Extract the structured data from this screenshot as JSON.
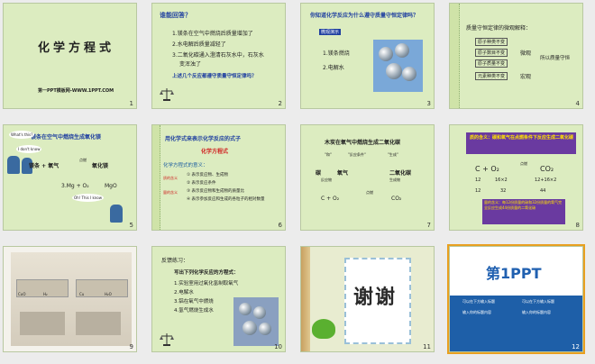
{
  "slides": [
    {
      "n": "1",
      "title": "化学方程式",
      "footer": "第一PPT模板网-WWW.1PPT.COM"
    },
    {
      "n": "2",
      "heading": "谁能回答？",
      "items": [
        "1.镁条在空气中燃烧后质量增加了",
        "2.水电解后质量减轻了",
        "3.二氧化碳通入澄清石灰水中，石灰水",
        "变浑浊了"
      ],
      "question": "上述几个反应都遵守质量守恒定律吗？"
    },
    {
      "n": "3",
      "heading": "你知道化学反应为什么遵守质量守恒定律吗？",
      "tag": "微观演示",
      "items": [
        "1.镁条燃烧",
        "2.电解水"
      ]
    },
    {
      "n": "4",
      "heading": "质量守恒定律的微观解释：",
      "rows": [
        "原子种类不变",
        "原子数目不变",
        "原子质量不变"
      ],
      "brace1": "微观",
      "brace2": "所以质量守恒",
      "extra": "元素种类不变",
      "extra2": "宏观"
    },
    {
      "n": "5",
      "heading": "镁条在空气中燃烧生成氧化镁",
      "bubble1": "What's this?",
      "bubble2": "I don't know",
      "bubble3": "Oh! This I know",
      "eq1": "镁条 + 氧气",
      "cond": "点燃",
      "product": "氧化镁",
      "eq2": "3.Mg + O₂",
      "eq2b": "MgO"
    },
    {
      "n": "6",
      "heading": "用化学式来表示化学反应的式子",
      "sub": "化学方程式",
      "intro": "化学方程式的意义：",
      "labels": [
        "质的含义",
        "量的含义"
      ],
      "items": [
        "① 表示反应物、生成物",
        "② 表示反应条件",
        "③ 表示反应物和生成物的质量比",
        "④ 表示参加反应和生成的各粒子的相对数量"
      ]
    },
    {
      "n": "7",
      "heading": "木炭在氧气中燃烧生成二氧化碳",
      "words": [
        "碳",
        "氧气",
        "二氧化碳"
      ],
      "labels": [
        "\"和\"",
        "\"反应条件\"",
        "\"生成\""
      ],
      "bottom": [
        "反应物",
        "生成物"
      ],
      "eq": "C  +  O₂",
      "cond": "点燃",
      "prod": "CO₂"
    },
    {
      "n": "8",
      "heading": "质的含义：碳和氧气在点燃条件下反应生成二氧化碳",
      "eq": "C + O₂",
      "cond": "点燃",
      "prod": "CO₂",
      "row1": [
        "12",
        "16×2",
        "12+16×2"
      ],
      "row2": [
        "12",
        "32",
        "44"
      ],
      "meaning": "量的含义：每12份质量的碳和32份质量的氧气完全反应生成44份质量的二氧化碳"
    },
    {
      "n": "9",
      "labels": [
        "CuO",
        "H₂",
        "Cu",
        "H₂O"
      ]
    },
    {
      "n": "10",
      "heading": "反馈练习：",
      "sub": "写出下列化学反应的方程式：",
      "items": [
        "1.实验室用过氧化氢制取氧气",
        "2.电解水",
        "3.铝在氧气中燃烧",
        "4.氢气燃烧生成水"
      ]
    },
    {
      "n": "11",
      "title": "谢谢"
    },
    {
      "n": "12",
      "logo": "第1PPT",
      "lines": [
        "可以在下方输入标题",
        "输入你的标题内容",
        "输入你的标题内容"
      ]
    }
  ],
  "colors": {
    "bg": "#dcecc0",
    "red": "#d02020",
    "blue": "#2040a0",
    "purple": "#6a3aa0",
    "accent": "#e8a020"
  }
}
